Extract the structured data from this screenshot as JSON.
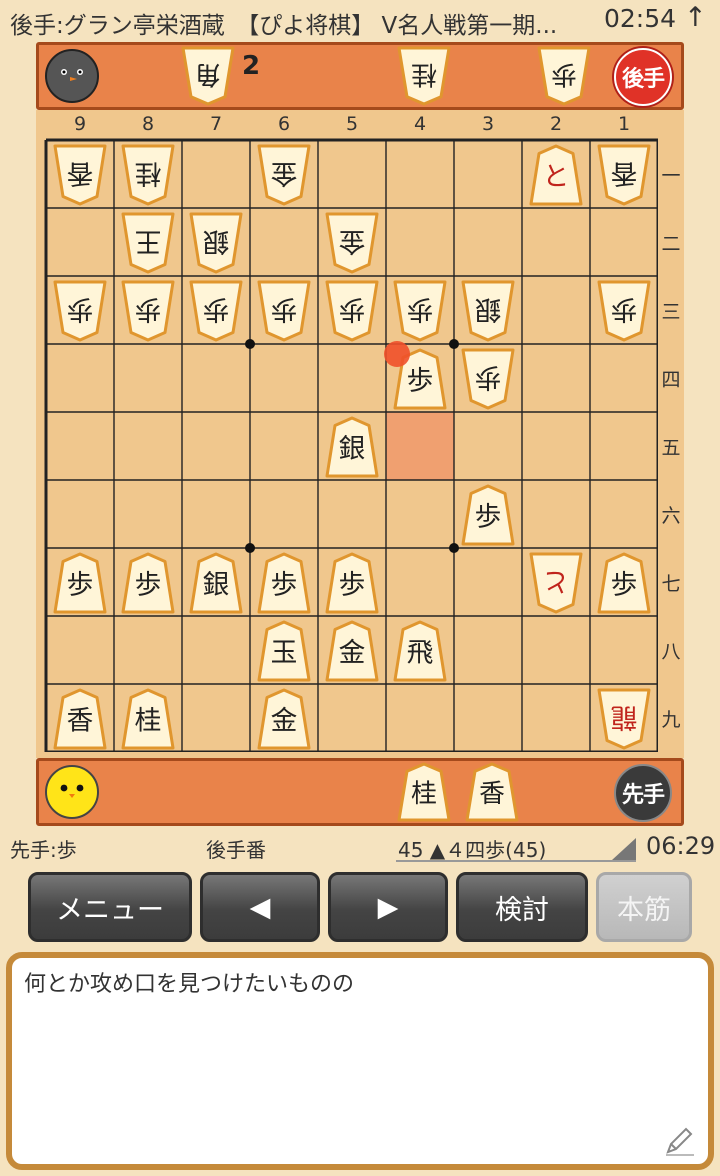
{
  "status": {
    "title": "後手:グラン亭栄酒蔵　【ぴよ将棋】 V名人戦第一期...",
    "time": "02:54",
    "arrow": "↑"
  },
  "board": {
    "files": [
      "9",
      "8",
      "7",
      "6",
      "5",
      "4",
      "3",
      "2",
      "1"
    ],
    "ranks": [
      "一",
      "二",
      "三",
      "四",
      "五",
      "六",
      "七",
      "八",
      "九"
    ],
    "pieces": [
      {
        "file": 9,
        "rank": 1,
        "label": "香",
        "owner": "gote",
        "promoted": false
      },
      {
        "file": 8,
        "rank": 1,
        "label": "桂",
        "owner": "gote",
        "promoted": false
      },
      {
        "file": 6,
        "rank": 1,
        "label": "金",
        "owner": "gote",
        "promoted": false
      },
      {
        "file": 2,
        "rank": 1,
        "label": "と",
        "owner": "sente",
        "promoted": true
      },
      {
        "file": 1,
        "rank": 1,
        "label": "香",
        "owner": "gote",
        "promoted": false
      },
      {
        "file": 8,
        "rank": 2,
        "label": "王",
        "owner": "gote",
        "promoted": false
      },
      {
        "file": 7,
        "rank": 2,
        "label": "銀",
        "owner": "gote",
        "promoted": false
      },
      {
        "file": 5,
        "rank": 2,
        "label": "金",
        "owner": "gote",
        "promoted": false
      },
      {
        "file": 9,
        "rank": 3,
        "label": "歩",
        "owner": "gote",
        "promoted": false
      },
      {
        "file": 8,
        "rank": 3,
        "label": "歩",
        "owner": "gote",
        "promoted": false
      },
      {
        "file": 7,
        "rank": 3,
        "label": "歩",
        "owner": "gote",
        "promoted": false
      },
      {
        "file": 6,
        "rank": 3,
        "label": "歩",
        "owner": "gote",
        "promoted": false
      },
      {
        "file": 5,
        "rank": 3,
        "label": "歩",
        "owner": "gote",
        "promoted": false
      },
      {
        "file": 4,
        "rank": 3,
        "label": "歩",
        "owner": "gote",
        "promoted": false
      },
      {
        "file": 3,
        "rank": 3,
        "label": "銀",
        "owner": "gote",
        "promoted": false
      },
      {
        "file": 1,
        "rank": 3,
        "label": "歩",
        "owner": "gote",
        "promoted": false
      },
      {
        "file": 4,
        "rank": 4,
        "label": "歩",
        "owner": "sente",
        "promoted": false
      },
      {
        "file": 3,
        "rank": 4,
        "label": "歩",
        "owner": "gote",
        "promoted": false
      },
      {
        "file": 5,
        "rank": 5,
        "label": "銀",
        "owner": "sente",
        "promoted": false
      },
      {
        "file": 3,
        "rank": 6,
        "label": "歩",
        "owner": "sente",
        "promoted": false
      },
      {
        "file": 9,
        "rank": 7,
        "label": "歩",
        "owner": "sente",
        "promoted": false
      },
      {
        "file": 8,
        "rank": 7,
        "label": "歩",
        "owner": "sente",
        "promoted": false
      },
      {
        "file": 7,
        "rank": 7,
        "label": "銀",
        "owner": "sente",
        "promoted": false
      },
      {
        "file": 6,
        "rank": 7,
        "label": "歩",
        "owner": "sente",
        "promoted": false
      },
      {
        "file": 5,
        "rank": 7,
        "label": "歩",
        "owner": "sente",
        "promoted": false
      },
      {
        "file": 2,
        "rank": 7,
        "label": "と",
        "owner": "gote",
        "promoted": true
      },
      {
        "file": 1,
        "rank": 7,
        "label": "歩",
        "owner": "sente",
        "promoted": false
      },
      {
        "file": 6,
        "rank": 8,
        "label": "玉",
        "owner": "sente",
        "promoted": false
      },
      {
        "file": 5,
        "rank": 8,
        "label": "金",
        "owner": "sente",
        "promoted": false
      },
      {
        "file": 4,
        "rank": 8,
        "label": "飛",
        "owner": "sente",
        "promoted": false
      },
      {
        "file": 9,
        "rank": 9,
        "label": "香",
        "owner": "sente",
        "promoted": false
      },
      {
        "file": 8,
        "rank": 9,
        "label": "桂",
        "owner": "sente",
        "promoted": false
      },
      {
        "file": 6,
        "rank": 9,
        "label": "金",
        "owner": "sente",
        "promoted": false
      },
      {
        "file": 1,
        "rank": 9,
        "label": "龍",
        "owner": "gote",
        "promoted": true
      }
    ],
    "last_move_from": {
      "file": 4,
      "rank": 5
    },
    "last_move_to": {
      "file": 4,
      "rank": 4
    }
  },
  "gote_hand": {
    "badge": "後手",
    "pieces": [
      {
        "label": "角",
        "count": "2"
      },
      {
        "label": "桂",
        "count": ""
      },
      {
        "label": "歩",
        "count": ""
      }
    ]
  },
  "sente_hand": {
    "badge": "先手",
    "pieces": [
      {
        "label": "桂",
        "count": ""
      },
      {
        "label": "香",
        "count": ""
      }
    ]
  },
  "info": {
    "sente_hand_text": "先手:歩",
    "turn": "後手番",
    "move": "45 ▲４四歩(45)",
    "clock": "06:29"
  },
  "buttons": {
    "menu": "メニュー",
    "prev": "◀",
    "next": "▶",
    "analyze": "検討",
    "mainline": "本筋"
  },
  "comment": {
    "text": "何とか攻め口を見つけたいものの"
  },
  "colors": {
    "background": "#f5e3bf",
    "board": "#f0c78d",
    "strip": "#e9834a",
    "piece_face": "#fff5d8",
    "piece_border": "#e0962e",
    "promoted_text": "#c0241c",
    "highlight": "#f0a070",
    "last_move_dot": "#f0502a"
  }
}
